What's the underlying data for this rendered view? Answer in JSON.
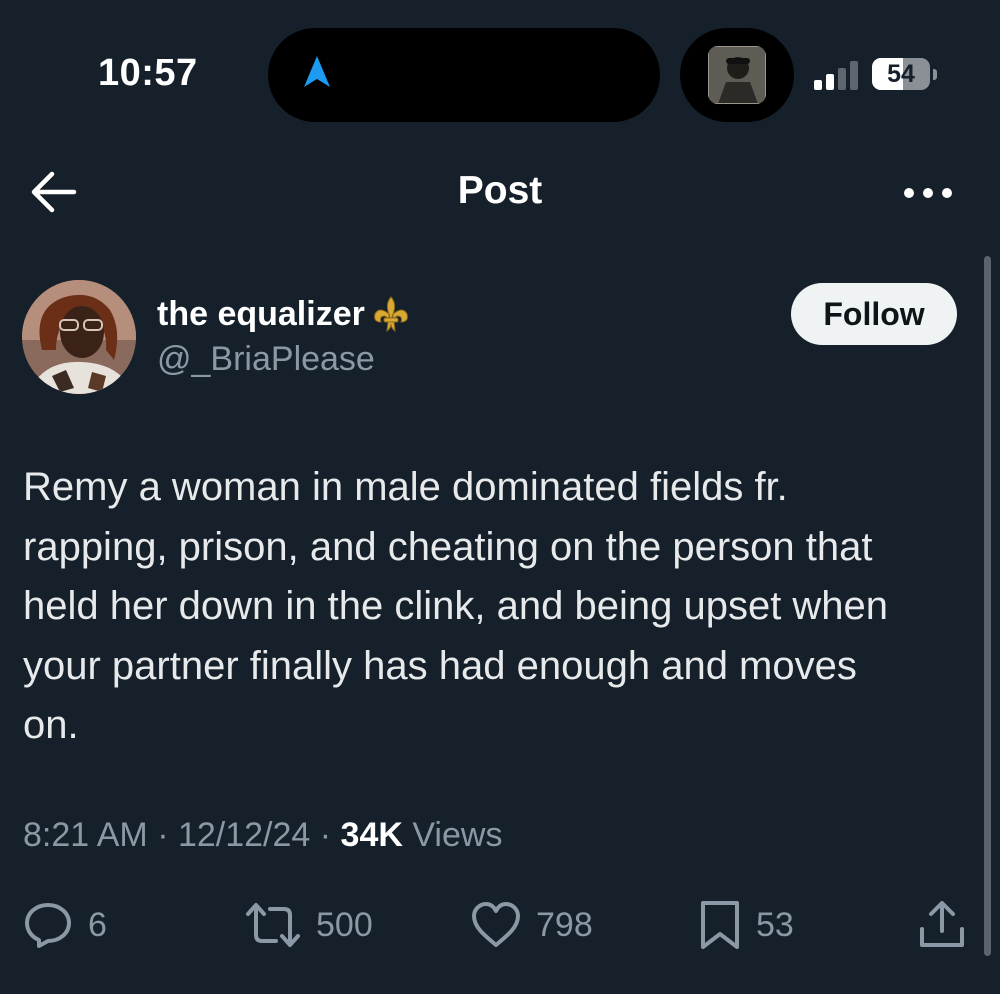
{
  "status_bar": {
    "time": "10:57",
    "battery_level": "54",
    "battery_fraction": 0.54,
    "icons": [
      "location-arrow-icon",
      "now-playing-art",
      "cellular-signal-icon",
      "battery-icon"
    ]
  },
  "header": {
    "title": "Post",
    "back_icon": "back-arrow-icon",
    "more_icon": "more-dots-icon"
  },
  "author": {
    "display_name": "the equalizer",
    "name_emoji": "fleur-de-lis-icon",
    "handle": "@_BriaPlease",
    "follow_label": "Follow"
  },
  "post": {
    "text": "Remy a woman in male dominated fields fr.\nrapping, prison, and cheating on the person that\nheld her down in the clink, and  being upset when\nyour partner finally has had enough and moves\non."
  },
  "meta": {
    "time": "8:21 AM",
    "sep1": " · ",
    "date": "12/12/24",
    "sep2": " · ",
    "views_count": "34K",
    "views_label": " Views"
  },
  "actions": {
    "replies": "6",
    "reposts": "500",
    "likes": "798",
    "bookmarks": "53"
  },
  "colors": {
    "background": "#15202b",
    "primary_text": "#e7e9ea",
    "secondary_text": "#8b98a5",
    "nav_blue": "#1d9bf0",
    "follow_bg": "#eff3f4"
  }
}
